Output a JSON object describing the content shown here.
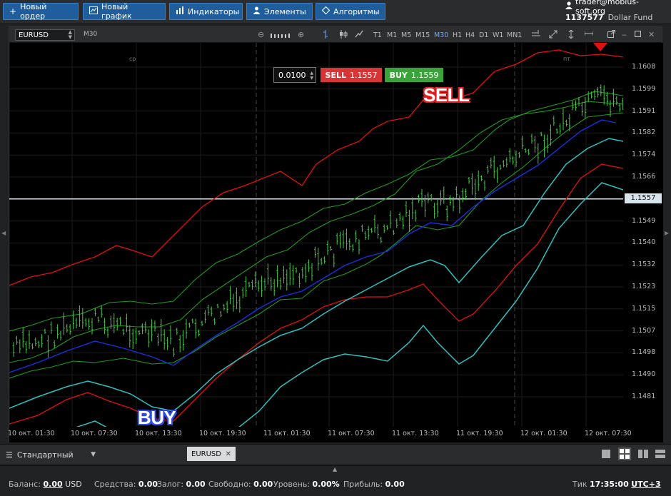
{
  "toolbar": {
    "new_order": "Новый ордер",
    "new_chart": "Новый график",
    "indicators": "Индикаторы",
    "elements": "Элементы",
    "algorithms": "Алгоритмы"
  },
  "user": {
    "email": "trader@mobius-soft.org",
    "account": "1137577",
    "fund": "Dollar Fund"
  },
  "chart": {
    "symbol": "EURUSD",
    "timeframe": "M30",
    "timeframes": [
      "T1",
      "M1",
      "M5",
      "M15",
      "M30",
      "H1",
      "H4",
      "D1",
      "W1",
      "MN1"
    ],
    "active_timeframe": "M30",
    "quantity": "0.0100",
    "sell_label": "SELL",
    "sell_price": "1.1557",
    "buy_label": "BUY",
    "buy_price": "1.1559",
    "current_price_tag": "1.1557",
    "marker_cp": "ср",
    "marker_pt": "пт",
    "signal_sell": "SELL",
    "signal_buy": "BUY",
    "price_ticks": [
      "1.1608",
      "1.1599",
      "1.1591",
      "1.1582",
      "1.1574",
      "1.1566",
      "1.1557",
      "1.1549",
      "1.1540",
      "1.1532",
      "1.1523",
      "1.1515",
      "1.1507",
      "1.1498",
      "1.1490",
      "1.1481"
    ],
    "time_ticks": [
      "10 окт. 01:30",
      "10 окт. 07:30",
      "10 окт. 13:30",
      "10 окт. 19:30",
      "11 окт. 01:30",
      "11 окт. 07:30",
      "11 окт. 13:30",
      "11 окт. 19:30",
      "12 окт. 01:30",
      "12 окт. 07:30"
    ],
    "colors": {
      "red_band": "#e01010",
      "green_band": "#1f9a1f",
      "cyan_band": "#2fbfbf",
      "blue_ma": "#1a2fe0",
      "candles": "#48c848"
    }
  },
  "tabs": {
    "layout": "Стандартный",
    "open_tab": "EURUSD"
  },
  "status": {
    "balance_label": "Баланс:",
    "balance_value": "0.00",
    "currency": "USD",
    "funds_label": "Средства:",
    "funds_value": "0.00",
    "margin_label": "Залог:",
    "margin_value": "0.00",
    "free_label": "Свободно:",
    "free_value": "0.00",
    "level_label": "Уровень:",
    "level_value": "0.00%",
    "profit_label": "Прибыль:",
    "profit_value": "0.00",
    "tick_label": "Тик",
    "tick_time": "17:35:00",
    "timezone": "UTC+3"
  }
}
